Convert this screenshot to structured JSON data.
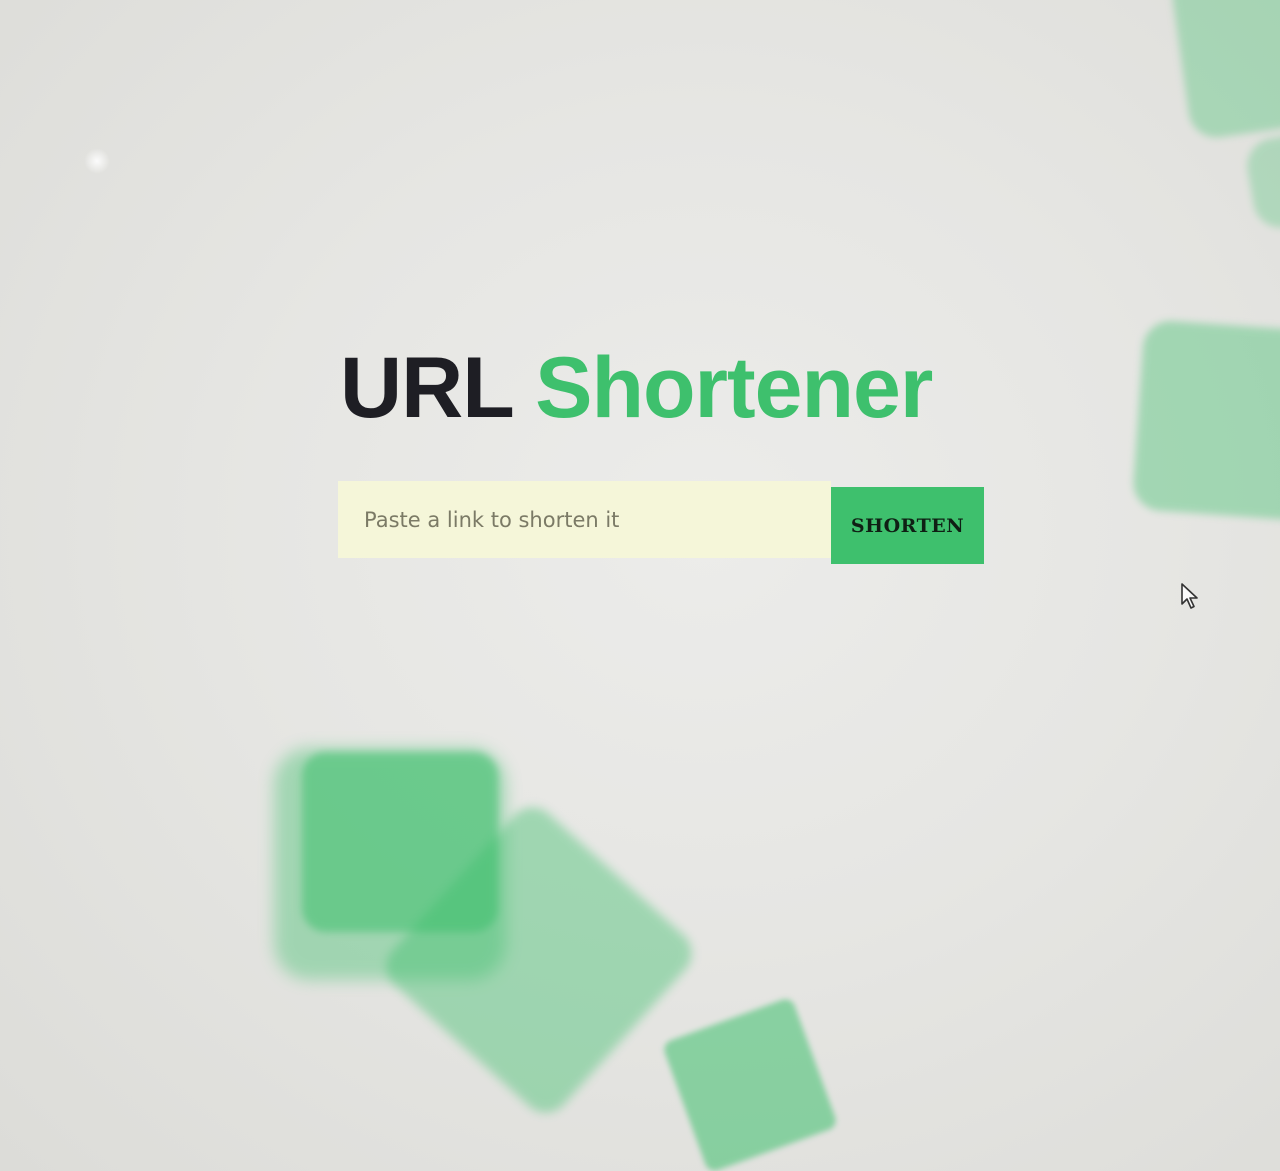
{
  "header": {
    "title_part1": "URL",
    "title_part2": "Shortener"
  },
  "form": {
    "input_placeholder": "Paste a link to shorten it",
    "input_value": "",
    "button_label": "SHORTEN"
  },
  "colors": {
    "accent": "#3ec06d",
    "title_dark": "#1e1e24",
    "input_background": "#f5f6d9",
    "page_background": "#e6e6e3"
  },
  "icons": {
    "cursor": "mouse-pointer-icon"
  }
}
